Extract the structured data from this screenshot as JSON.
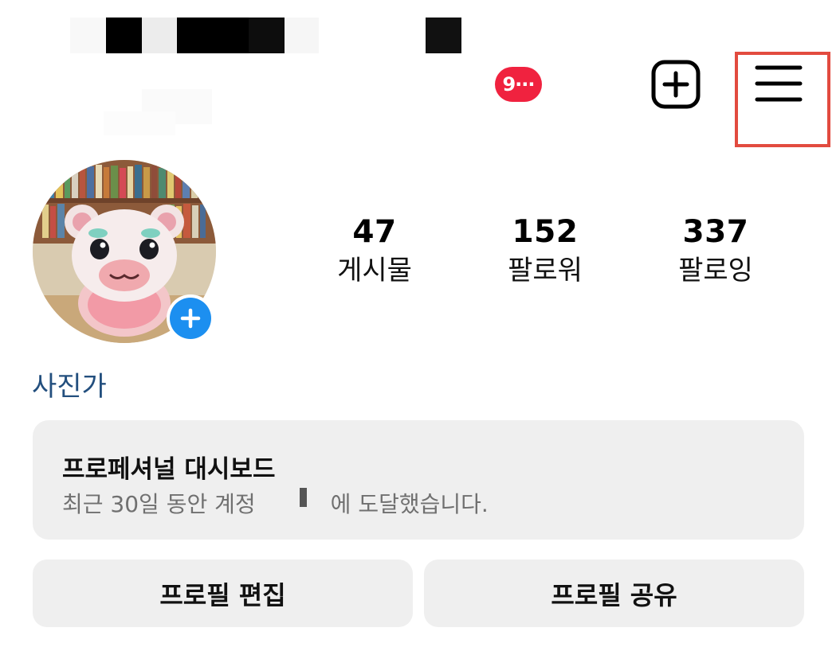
{
  "header": {
    "notification_badge": "9···",
    "new_post_icon": "plus-square-icon",
    "menu_icon": "hamburger-menu-icon",
    "highlight_color": "#e24b3f"
  },
  "profile": {
    "avatar_icon": "profile-avatar",
    "add_story_icon": "plus-icon",
    "category": "사진가"
  },
  "stats": [
    {
      "value": "47",
      "label": "게시물"
    },
    {
      "value": "152",
      "label": "팔로워"
    },
    {
      "value": "337",
      "label": "팔로잉"
    }
  ],
  "dashboard": {
    "title": "프로페셔널 대시보드",
    "subtitle_prefix": "최근 30일 동안 계정",
    "subtitle_suffix": "에 도달했습니다."
  },
  "actions": {
    "edit_profile": "프로필 편집",
    "share_profile": "프로필 공유"
  },
  "colors": {
    "badge": "#f0223f",
    "accent_blue": "#1c8ff0",
    "category_text": "#234f7e",
    "card_bg": "#efefef"
  }
}
